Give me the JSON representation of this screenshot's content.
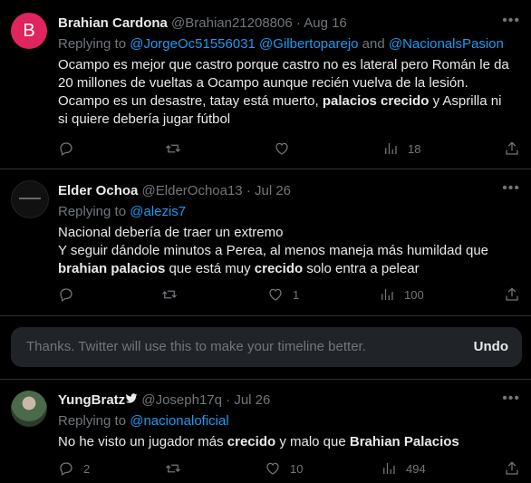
{
  "tweets": [
    {
      "name": "Brahian Cardona",
      "handle": "@Brahian21208806",
      "dot": "·",
      "date": "Aug 16",
      "avatar_letter": "B",
      "avatar_color": "#e0245e",
      "replying_prefix": "Replying to",
      "mention_1": "@JorgeOc51556031",
      "mention_2": "@Gilbertoparejo",
      "and": "and",
      "mention_3": "@NacionalsPasion",
      "line1": "Ocampo es mejor que castro porque castro no es lateral pero Román le da",
      "line2": "20 millones de vueltas a Ocampo aunque recién vuelva de la lesión.",
      "line3a": "Ocampo es un desastre, tatay está muerto,",
      "line3b": "palacios crecido",
      "line3c": "y Asprilla ni",
      "line4": "si quiere debería jugar fútbol",
      "like_count": "",
      "views": "18"
    },
    {
      "name": "Elder Ochoa",
      "handle": "@ElderOchoa13",
      "dot": "·",
      "date": "Jul 26",
      "replying_prefix": "Replying to",
      "mention_1": "@alezis7",
      "line1": "Nacional debería de traer un extremo",
      "line2": "Y seguir dándole minutos a Perea, al menos maneja más humildad que",
      "line3a": "brahian palacios",
      "line3b": "que está muy",
      "line3c": "crecido",
      "line3d": "solo entra a pelear",
      "like_count": "1",
      "views": "100"
    },
    {
      "name": "YungBratz",
      "handle": "@Joseph17q",
      "dot": "·",
      "date": "Jul 26",
      "replying_prefix": "Replying to",
      "mention_1": "@nacionaloficial",
      "line1a": "No he visto un jugador más",
      "line1b": "crecido",
      "line1c": "y malo que",
      "line1d": "Brahian Palacios",
      "reply_count": "2",
      "like_count": "10",
      "views": "494"
    }
  ],
  "banner": {
    "message": "Thanks. Twitter will use this to make your timeline better.",
    "undo": "Undo"
  },
  "icons": {
    "more": "more-icon",
    "reply": "reply-icon",
    "retweet": "retweet-icon",
    "like": "like-icon",
    "views": "views-icon",
    "share": "share-icon"
  },
  "colors": {
    "mention": "#1d9bf0",
    "muted": "#71767b",
    "text": "#e7e9ea",
    "background": "#000000"
  }
}
